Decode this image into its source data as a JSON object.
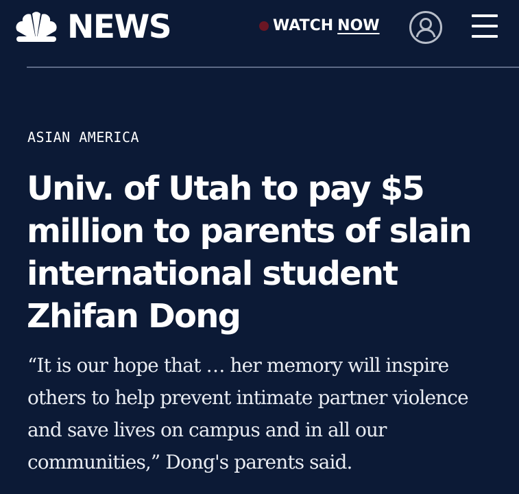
{
  "header": {
    "logo_text": "NEWS",
    "watch_label": "WATCH",
    "watch_now_label": "NOW",
    "icons": {
      "logo": "peacock-icon",
      "account": "account-icon",
      "menu": "hamburger-menu-icon",
      "live": "live-dot-icon"
    }
  },
  "article": {
    "category": "ASIAN AMERICA",
    "headline": "Univ. of Utah to pay $5 million to parents of slain international student Zhifan Dong",
    "dek": "“It is our hope that … her memory will inspire others to help prevent intimate partner violence and save lives on campus and in all our communities,” Dong's parents said."
  },
  "colors": {
    "background": "#0c1a36",
    "text": "#ffffff",
    "live_dot": "#6b1624",
    "divider": "#5e6a86"
  }
}
